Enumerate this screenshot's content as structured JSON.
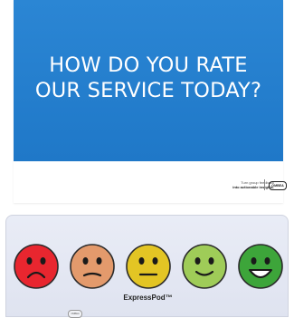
{
  "sign": {
    "headline_line1": "HOW DO YOU RATE",
    "headline_line2": "OUR SERVICE TODAY?",
    "tagline_line1": "Turn group feedback",
    "tagline_line2": "into actionable insights.",
    "brand": "OMBEA",
    "panel_color": "#1f78c8"
  },
  "device": {
    "name": "ExpressPod™",
    "logo": "OMBEA",
    "buttons": [
      {
        "name": "very-unhappy-face-button",
        "icon": "frown-face-icon",
        "color": "#e8262f",
        "mouth": "frown"
      },
      {
        "name": "unhappy-face-button",
        "icon": "slight-frown-face-icon",
        "color": "#e39a6c",
        "mouth": "slight-frown"
      },
      {
        "name": "neutral-face-button",
        "icon": "neutral-face-icon",
        "color": "#e3c524",
        "mouth": "neutral"
      },
      {
        "name": "happy-face-button",
        "icon": "smile-face-icon",
        "color": "#9fcc58",
        "mouth": "smile"
      },
      {
        "name": "very-happy-face-button",
        "icon": "grin-face-icon",
        "color": "#3da53a",
        "mouth": "grin"
      }
    ]
  }
}
